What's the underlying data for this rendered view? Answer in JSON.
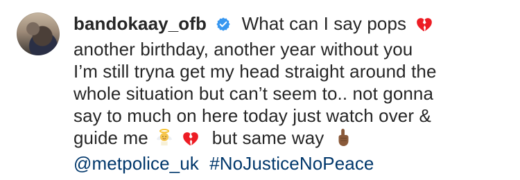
{
  "comment": {
    "username": "bandokaay_ofb",
    "verified": true,
    "lines": [
      "What can I say pops",
      "another birthday, another year without you",
      "I’m still tryna get my head straight around the",
      "whole situation but can’t seem to.. not gonna",
      "say to much on here today just watch over &",
      "guide me",
      "but same way"
    ],
    "mentions": {
      "user": "@metpolice_uk",
      "hashtag": "#NoJusticeNoPeace"
    },
    "icons": {
      "verified": "verified-badge-icon",
      "broken_heart": "broken-heart-emoji",
      "angel": "baby-angel-emoji",
      "finger": "index-pointing-up-emoji"
    },
    "colors": {
      "text": "#262626",
      "link": "#00376b",
      "verified": "#3897f0",
      "heart": "#ed1c24"
    }
  }
}
